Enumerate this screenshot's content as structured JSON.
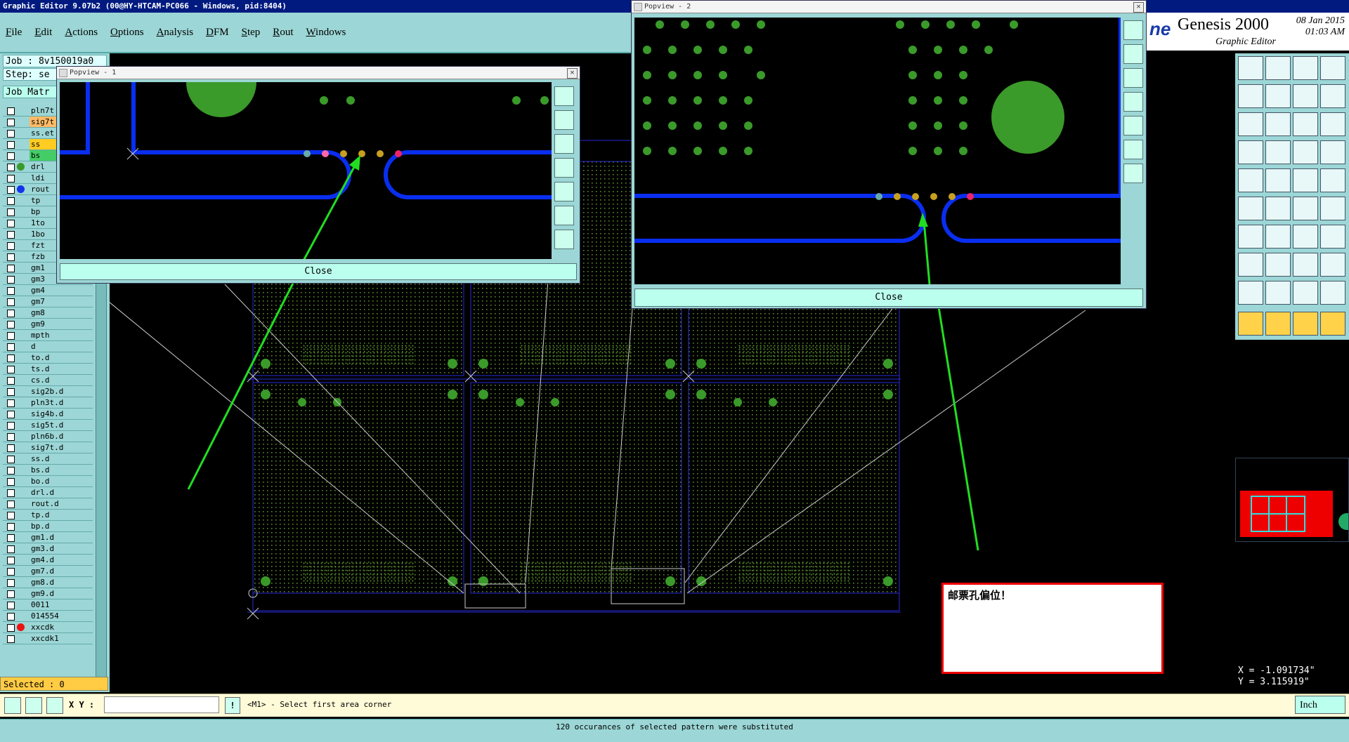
{
  "window": {
    "title": "Graphic Editor 9.07b2 (00@HY-HTCAM-PC066 - Windows, pid:8404)"
  },
  "menu": [
    "File",
    "Edit",
    "Actions",
    "Options",
    "Analysis",
    "DFM",
    "Step",
    "Rout",
    "Windows"
  ],
  "brand": {
    "logo_fragment": "ne",
    "name": "Genesis 2000",
    "subtitle": "Graphic Editor",
    "date": "08 Jan 2015",
    "time": "01:03 AM"
  },
  "left_panel": {
    "job": "Job : 8v150019a0",
    "step": "Step: se",
    "job_matrix": "Job Matr",
    "layers": [
      {
        "name": "pln7t",
        "highlight": "#9cd6d6",
        "dot": ""
      },
      {
        "name": "sig7t",
        "highlight": "#ffbb66",
        "dot": ""
      },
      {
        "name": "ss.et",
        "highlight": "#9cd6d6",
        "dot": ""
      },
      {
        "name": "ss",
        "highlight": "#ffcc22",
        "dot": ""
      },
      {
        "name": "bs",
        "highlight": "#44cc66",
        "dot": ""
      },
      {
        "name": "drl",
        "highlight": "#9cd6d6",
        "dot": "#3a9a2a"
      },
      {
        "name": "ldi",
        "highlight": "#9cd6d6",
        "dot": ""
      },
      {
        "name": "rout",
        "highlight": "#9cd6d6",
        "dot": "#1133ee"
      },
      {
        "name": "tp",
        "highlight": "#9cd6d6",
        "dot": ""
      },
      {
        "name": "bp",
        "highlight": "#9cd6d6",
        "dot": ""
      },
      {
        "name": "1to",
        "highlight": "#9cd6d6",
        "dot": ""
      },
      {
        "name": "1bo",
        "highlight": "#9cd6d6",
        "dot": ""
      },
      {
        "name": "fzt",
        "highlight": "#9cd6d6",
        "dot": ""
      },
      {
        "name": "fzb",
        "highlight": "#9cd6d6",
        "dot": ""
      },
      {
        "name": "gm1",
        "highlight": "#9cd6d6",
        "dot": ""
      },
      {
        "name": "gm3",
        "highlight": "#9cd6d6",
        "dot": ""
      },
      {
        "name": "gm4",
        "highlight": "#9cd6d6",
        "dot": ""
      },
      {
        "name": "gm7",
        "highlight": "#9cd6d6",
        "dot": ""
      },
      {
        "name": "gm8",
        "highlight": "#9cd6d6",
        "dot": ""
      },
      {
        "name": "gm9",
        "highlight": "#9cd6d6",
        "dot": ""
      },
      {
        "name": "mpth",
        "highlight": "#9cd6d6",
        "dot": ""
      },
      {
        "name": "d",
        "highlight": "#9cd6d6",
        "dot": ""
      },
      {
        "name": "to.d",
        "highlight": "#9cd6d6",
        "dot": ""
      },
      {
        "name": "ts.d",
        "highlight": "#9cd6d6",
        "dot": ""
      },
      {
        "name": "cs.d",
        "highlight": "#9cd6d6",
        "dot": ""
      },
      {
        "name": "sig2b.d",
        "highlight": "#9cd6d6",
        "dot": ""
      },
      {
        "name": "pln3t.d",
        "highlight": "#9cd6d6",
        "dot": ""
      },
      {
        "name": "sig4b.d",
        "highlight": "#9cd6d6",
        "dot": ""
      },
      {
        "name": "sig5t.d",
        "highlight": "#9cd6d6",
        "dot": ""
      },
      {
        "name": "pln6b.d",
        "highlight": "#9cd6d6",
        "dot": ""
      },
      {
        "name": "sig7t.d",
        "highlight": "#9cd6d6",
        "dot": ""
      },
      {
        "name": "ss.d",
        "highlight": "#9cd6d6",
        "dot": ""
      },
      {
        "name": "bs.d",
        "highlight": "#9cd6d6",
        "dot": ""
      },
      {
        "name": "bo.d",
        "highlight": "#9cd6d6",
        "dot": ""
      },
      {
        "name": "drl.d",
        "highlight": "#9cd6d6",
        "dot": ""
      },
      {
        "name": "rout.d",
        "highlight": "#9cd6d6",
        "dot": ""
      },
      {
        "name": "tp.d",
        "highlight": "#9cd6d6",
        "dot": ""
      },
      {
        "name": "bp.d",
        "highlight": "#9cd6d6",
        "dot": ""
      },
      {
        "name": "gm1.d",
        "highlight": "#9cd6d6",
        "dot": ""
      },
      {
        "name": "gm3.d",
        "highlight": "#9cd6d6",
        "dot": ""
      },
      {
        "name": "gm4.d",
        "highlight": "#9cd6d6",
        "dot": ""
      },
      {
        "name": "gm7.d",
        "highlight": "#9cd6d6",
        "dot": ""
      },
      {
        "name": "gm8.d",
        "highlight": "#9cd6d6",
        "dot": ""
      },
      {
        "name": "gm9.d",
        "highlight": "#9cd6d6",
        "dot": ""
      },
      {
        "name": "0011",
        "highlight": "#9cd6d6",
        "dot": ""
      },
      {
        "name": "014554",
        "highlight": "#9cd6d6",
        "dot": ""
      },
      {
        "name": "xxcdk",
        "highlight": "#9cd6d6",
        "dot": "#ee1111"
      },
      {
        "name": "xxcdk1",
        "highlight": "#9cd6d6",
        "dot": ""
      }
    ],
    "selected": "Selected : 0"
  },
  "popview1": {
    "title": "Popview - 1",
    "close_label": "Close"
  },
  "popview2": {
    "title": "Popview - 2",
    "close_label": "Close"
  },
  "command_bar": {
    "xy_label": "X Y :",
    "xy_value": "",
    "prompt": "<M1> - Select first area corner",
    "unit": "Inch"
  },
  "status": {
    "message": "120 occurances of selected pattern were substituted"
  },
  "coordinates": {
    "x": "X = -1.091734\"",
    "y": "Y =  3.115919\""
  },
  "annotation": {
    "text": "邮票孔偏位！"
  },
  "colors": {
    "panel": "#9cd6d6",
    "trace": "#0a2ef0",
    "pad": "#3a9a2a",
    "arrow": "#22dd22",
    "alert": "#ee0000"
  }
}
